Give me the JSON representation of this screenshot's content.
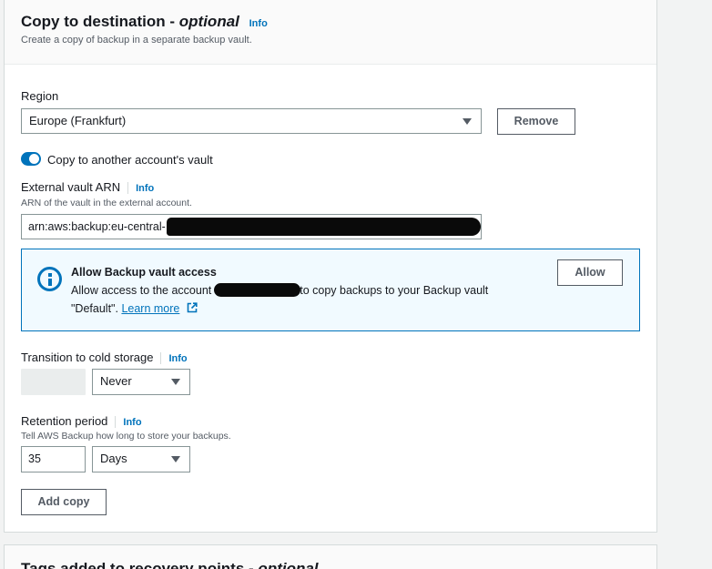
{
  "copy_section": {
    "title": "Copy to destination -",
    "title_optional": "optional",
    "info": "Info",
    "subtitle": "Create a copy of backup in a separate backup vault."
  },
  "region": {
    "label": "Region",
    "value": "Europe (Frankfurt)",
    "remove_label": "Remove"
  },
  "toggle": {
    "label": "Copy to another account's vault",
    "checked": true
  },
  "external_vault": {
    "label": "External vault ARN",
    "info": "Info",
    "description": "ARN of the vault in the external account.",
    "value": "arn:aws:backup:eu-central-"
  },
  "alert": {
    "title": "Allow Backup vault access",
    "text_before": "Allow access to the account",
    "text_after": "to copy backups to your Backup vault",
    "text_line2": "\"Default\".",
    "link": "Learn more",
    "allow_label": "Allow"
  },
  "cold_storage": {
    "label": "Transition to cold storage",
    "info": "Info",
    "value": "Never"
  },
  "retention": {
    "label": "Retention period",
    "info": "Info",
    "description": "Tell AWS Backup how long to store your backups.",
    "value": "35",
    "unit": "Days"
  },
  "add_copy_label": "Add copy",
  "tags_section": {
    "title": "Tags added to recovery points -",
    "title_optional": "optional"
  },
  "colors": {
    "accent": "#0073bb",
    "alert_bg": "#f1faff"
  }
}
